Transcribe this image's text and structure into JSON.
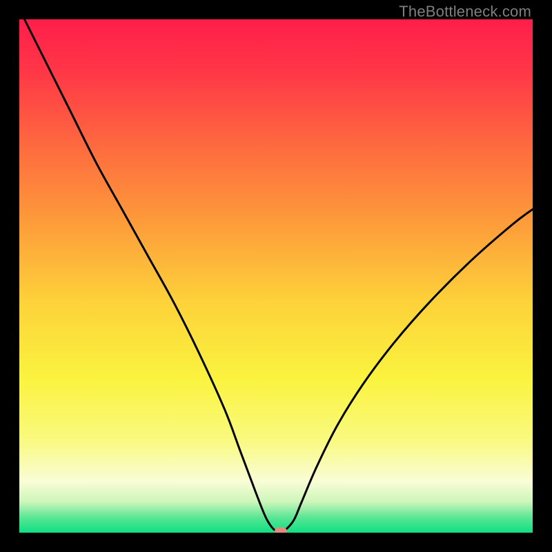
{
  "watermark": "TheBottleneck.com",
  "chart_data": {
    "type": "line",
    "title": "",
    "xlabel": "",
    "ylabel": "",
    "xlim": [
      0,
      100
    ],
    "ylim": [
      0,
      100
    ],
    "gradient_stops": [
      {
        "offset": 0.0,
        "color": "#FF1E4A"
      },
      {
        "offset": 0.1,
        "color": "#FF3647"
      },
      {
        "offset": 0.25,
        "color": "#FE6B3F"
      },
      {
        "offset": 0.4,
        "color": "#FD9D3A"
      },
      {
        "offset": 0.55,
        "color": "#FDD23A"
      },
      {
        "offset": 0.7,
        "color": "#FAF33E"
      },
      {
        "offset": 0.82,
        "color": "#F9FA80"
      },
      {
        "offset": 0.9,
        "color": "#F9FDD6"
      },
      {
        "offset": 0.94,
        "color": "#CDF6BA"
      },
      {
        "offset": 0.97,
        "color": "#5BE695"
      },
      {
        "offset": 1.0,
        "color": "#0EDF83"
      }
    ],
    "series": [
      {
        "name": "bottleneck-curve",
        "x": [
          1,
          3,
          6,
          10,
          15,
          20,
          25,
          30,
          35,
          40,
          43,
          46,
          48,
          49.5,
          50.5,
          51,
          52,
          53.5,
          55,
          58,
          62,
          67,
          73,
          80,
          88,
          96,
          100
        ],
        "y": [
          100,
          96,
          90,
          82,
          72,
          63,
          54,
          45,
          35,
          24,
          16,
          8,
          3,
          0.7,
          0.3,
          0.3,
          0.7,
          2.5,
          6,
          13,
          21,
          29,
          37,
          45,
          53,
          60,
          63
        ]
      }
    ],
    "marker": {
      "x": 51,
      "y": 0.3,
      "color": "#E58A7E"
    },
    "annotations": []
  }
}
